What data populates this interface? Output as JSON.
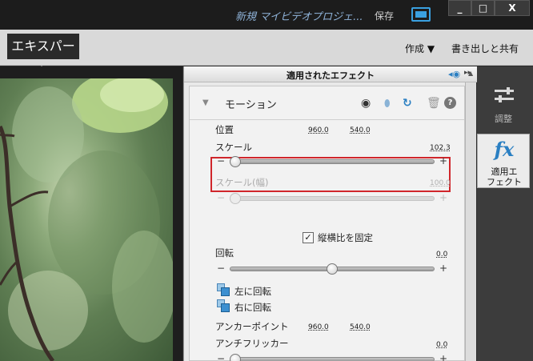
{
  "titlebar": {
    "project_title": "新規 マイビデオプロジェ...",
    "save": "保存",
    "minimize": "_",
    "maximize": "□",
    "close": "X"
  },
  "menubar": {
    "mode_tab": "エキスパート",
    "create": "作成 ▼",
    "export": "書き出しと共有"
  },
  "panel": {
    "title": "適用されたエフェクト",
    "effect_name": "モーション",
    "params": {
      "position": {
        "label": "位置",
        "x": "960.0",
        "y": "540.0"
      },
      "scale": {
        "label": "スケール",
        "value": "102.3",
        "level": 0.0
      },
      "scale_width": {
        "label": "スケール(幅)",
        "value": "100.0",
        "level": 0.0
      },
      "uniform_scale": {
        "label": "縦横比を固定",
        "checked": true
      },
      "rotation": {
        "label": "回転",
        "value": "0.0",
        "level": 0.5
      },
      "rotate_left": "左に回転",
      "rotate_right": "右に回転",
      "anchor_point": {
        "label": "アンカーポイント",
        "x": "960.0",
        "y": "540.0"
      },
      "anti_flicker": {
        "label": "アンチフリッカー",
        "value": "0.0",
        "level": 0.0
      }
    },
    "minus": "−",
    "plus": "+"
  },
  "sidebar": {
    "adjust": "調整",
    "effects": "適用エ\nフェクト"
  },
  "icons": [
    "eye-icon",
    "drop-icon",
    "reset-icon",
    "trash-icon",
    "help-icon",
    "adjust-icon",
    "fx-icon",
    "screen-icon"
  ],
  "colors": {
    "accent": "#2a7fc2",
    "highlight": "#d0262b"
  }
}
